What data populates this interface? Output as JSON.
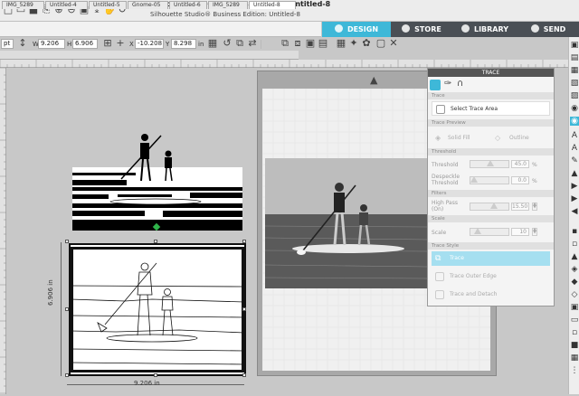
{
  "app": {
    "title": "Silhouette Studio® Business Edition: Untitled-8",
    "subtitle": "Silhouette Studio® Business Edition: Untitled-8"
  },
  "nav": {
    "design": "DESIGN",
    "store": "STORE",
    "library": "LIBRARY",
    "send": "SEND",
    "active": "DESIGN",
    "accent": "#3eb8d8",
    "dark": "#4a4f55"
  },
  "toolbar": {
    "units": "pt",
    "w_label": "W",
    "w_value": "9.206",
    "h_label": "H",
    "h_value": "6.906",
    "x_label": "X",
    "x_value": "-10.208",
    "y_label": "Y",
    "y_value": "8.298",
    "y_unit": "in"
  },
  "doc_tabs": [
    "IMG_5289",
    "Untitled-4",
    "Untitled-5",
    "Gnome-05",
    "Untitled-6",
    "IMG_5289",
    "Untitled-8"
  ],
  "active_doc_tab": 6,
  "dimensions": {
    "width": "9.206 in",
    "height": "6.906 in"
  },
  "trace_panel": {
    "title": "TRACE",
    "trace_header": "Trace",
    "select_area": "Select Trace Area",
    "preview_header": "Trace Preview",
    "solid_fill": "Solid Fill",
    "outline": "Outline",
    "threshold_header": "Threshold",
    "threshold_label": "Threshold",
    "threshold_value": "45.0",
    "threshold_unit": "%",
    "despeckle_label_1": "Despeckle",
    "despeckle_label_2": "Threshold",
    "despeckle_value": "0.0",
    "despeckle_unit": "%",
    "filters_header": "Filters",
    "highpass_label_1": "High Pass",
    "highpass_label_2": "(On)",
    "highpass_value": "15.50",
    "scale_header": "Scale",
    "scale_label": "Scale",
    "scale_value": "10",
    "style_header": "Trace Style",
    "trace": "Trace",
    "trace_outer_edge": "Trace Outer Edge",
    "trace_and_detach": "Trace and Detach",
    "selected_color": "#a5dff0"
  }
}
